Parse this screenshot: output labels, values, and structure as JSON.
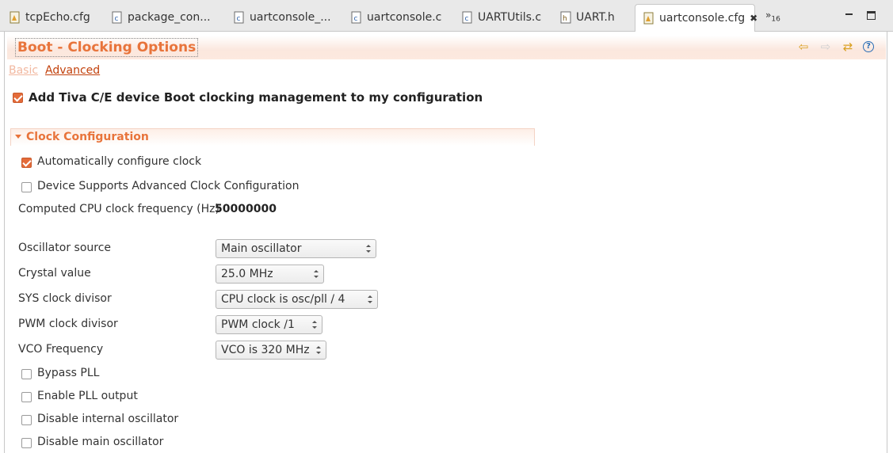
{
  "tabs": [
    {
      "label": "tcpEcho.cfg",
      "icon": "cfg-file-icon"
    },
    {
      "label": "package_con...",
      "icon": "c-file-icon"
    },
    {
      "label": "uartconsole_...",
      "icon": "c-file-icon"
    },
    {
      "label": "uartconsole.c",
      "icon": "c-file-icon"
    },
    {
      "label": "UARTUtils.c",
      "icon": "c-file-icon"
    },
    {
      "label": "UART.h",
      "icon": "h-file-icon"
    },
    {
      "label": "uartconsole.cfg",
      "icon": "cfg-file-icon",
      "active": true
    }
  ],
  "tab_overflow": {
    "symbol": "»",
    "count": "16"
  },
  "page": {
    "title": "Boot - Clocking Options"
  },
  "mode_links": {
    "basic": "Basic",
    "advanced": "Advanced"
  },
  "main_checkbox": {
    "label": "Add Tiva C/E device Boot clocking management to my configuration",
    "checked": true
  },
  "section": {
    "title": "Clock Configuration",
    "auto_configure": {
      "label": "Automatically configure clock",
      "checked": true
    },
    "advanced_clock": {
      "label": "Device Supports Advanced Clock Configuration",
      "checked": false
    },
    "cpu_freq": {
      "label": "Computed CPU clock frequency (Hz)",
      "value": "50000000"
    },
    "fields": {
      "oscillator": {
        "label": "Oscillator source",
        "value": "Main oscillator"
      },
      "crystal": {
        "label": "Crystal value",
        "value": "25.0 MHz"
      },
      "sys_divisor": {
        "label": "SYS clock divisor",
        "value": "CPU clock is osc/pll / 4"
      },
      "pwm_divisor": {
        "label": "PWM clock divisor",
        "value": "PWM clock /1"
      },
      "vco": {
        "label": "VCO Frequency",
        "value": "VCO is 320 MHz"
      }
    },
    "options": [
      {
        "label": "Bypass PLL",
        "checked": false
      },
      {
        "label": "Enable PLL output",
        "checked": false
      },
      {
        "label": "Disable internal oscillator",
        "checked": false
      },
      {
        "label": "Disable main oscillator",
        "checked": false
      }
    ]
  },
  "colors": {
    "accent": "#e8743b",
    "link": "#c2410c",
    "checkbox": "#e46b3a"
  }
}
